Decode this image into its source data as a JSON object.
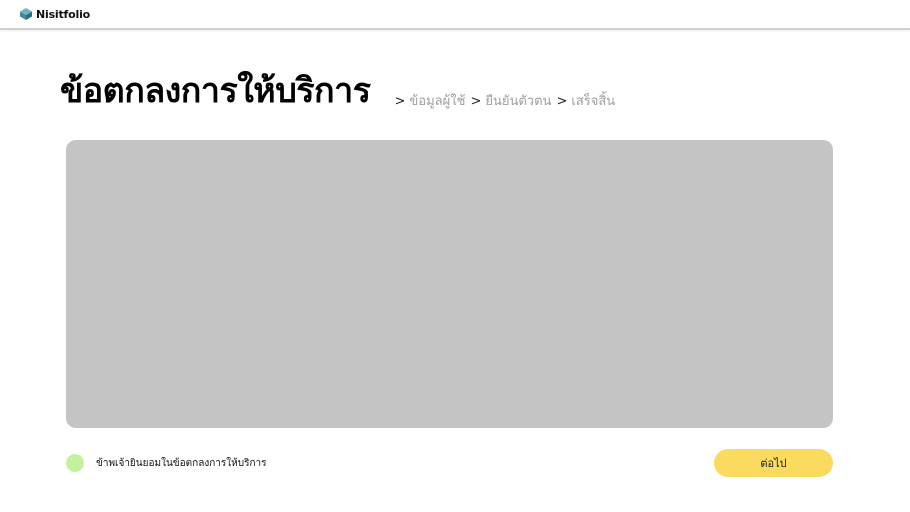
{
  "app": {
    "logo_text": "Nisitfolio",
    "logo_icon": "stacked-layers-icon",
    "accent_colors": {
      "logo_icon_top": "#6fb5c0",
      "logo_icon_bottom": "#2f6e7f",
      "agree_indicator": "#c2f2a0",
      "next_button": "#fadb5f",
      "terms_box": "#c4c4c4"
    }
  },
  "header": {
    "title": "ข้อตกลงการให้บริการ"
  },
  "breadcrumb": {
    "separator": ">",
    "steps": [
      {
        "label": "ข้อมูลผู้ใช้"
      },
      {
        "label": "ยืนยันตัวตน"
      },
      {
        "label": "เสร็จสิ้น"
      }
    ]
  },
  "terms": {
    "content": ""
  },
  "agreement": {
    "label": "ข้าพเจ้ายินยอมในข้อตกลงการให้บริการ"
  },
  "actions": {
    "next_label": "ต่อไป"
  }
}
